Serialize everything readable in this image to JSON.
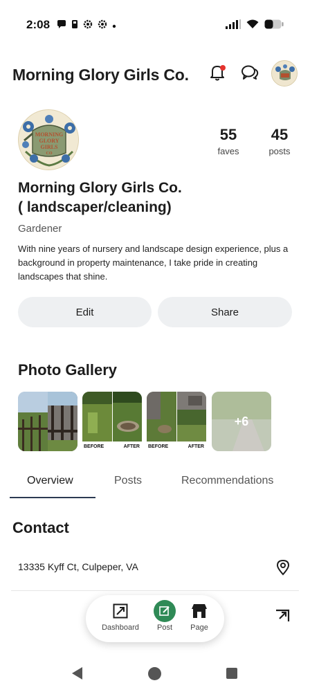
{
  "status_bar": {
    "time": "2:08"
  },
  "header": {
    "title": "Morning Glory Girls Co.",
    "has_notification": true
  },
  "profile": {
    "name": "Morning Glory Girls Co.\n( landscaper/cleaning)",
    "name_line1": "Morning Glory Girls Co.",
    "name_line2": "( landscaper/cleaning)",
    "category": "Gardener",
    "bio": "With nine years of nursery and landscape design experience, plus a background in property maintenance, I take pride in creating landscapes that shine.",
    "stats": [
      {
        "value": "55",
        "label": "faves"
      },
      {
        "value": "45",
        "label": "posts"
      }
    ],
    "logo_text": [
      "MORNING",
      "GLORY",
      "GIRLS",
      "CO"
    ]
  },
  "actions": {
    "edit_label": "Edit",
    "share_label": "Share"
  },
  "gallery": {
    "title": "Photo Gallery",
    "thumbnails": [
      {
        "kind": "photo"
      },
      {
        "kind": "before-after",
        "before": "BEFORE",
        "after": "AFTER"
      },
      {
        "kind": "before-after",
        "before": "BEFORE",
        "after": "AFTER"
      },
      {
        "kind": "more",
        "more_label": "+6"
      }
    ]
  },
  "tabs": [
    {
      "label": "Overview",
      "active": true
    },
    {
      "label": "Posts",
      "active": false
    },
    {
      "label": "Recommendations",
      "active": false
    }
  ],
  "contact": {
    "title": "Contact",
    "address": "13335 Kyff Ct, Culpeper, VA"
  },
  "bottom_nav": [
    {
      "label": "Dashboard",
      "icon": "dashboard-icon"
    },
    {
      "label": "Post",
      "icon": "edit-icon"
    },
    {
      "label": "Page",
      "icon": "storefront-icon"
    }
  ],
  "colors": {
    "accent_green": "#2f8a56",
    "notification_red": "#e5322d",
    "tab_underline": "#2b3a52",
    "button_bg": "#eef0f2"
  }
}
